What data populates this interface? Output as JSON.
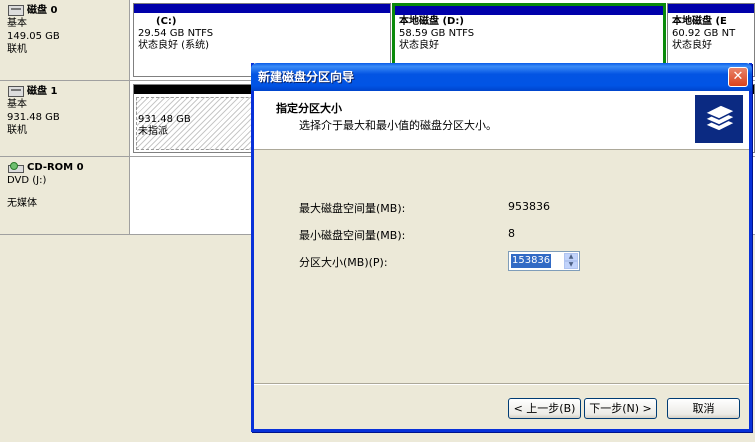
{
  "disks": [
    {
      "name": "磁盘 0",
      "type": "基本",
      "size": "149.05 GB",
      "status": "联机"
    },
    {
      "name": "磁盘 1",
      "type": "基本",
      "size": "931.48 GB",
      "status": "联机"
    },
    {
      "name": "CD-ROM 0",
      "type": "DVD (J:)",
      "status": "无媒体"
    }
  ],
  "partitions": {
    "c": {
      "label": "(C:)",
      "size": "29.54 GB NTFS",
      "status": "状态良好 (系统)"
    },
    "d": {
      "label": "本地磁盘  (D:)",
      "size": "58.59 GB NTFS",
      "status": "状态良好"
    },
    "e": {
      "label": "本地磁盘  (E",
      "size": "60.92 GB NT",
      "status": "状态良好"
    },
    "unalloc": {
      "size": "931.48 GB",
      "status": "未指派"
    }
  },
  "wizard": {
    "title": "新建磁盘分区向导",
    "close": "✕",
    "header_title": "指定分区大小",
    "header_subtitle": "选择介于最大和最小值的磁盘分区大小。",
    "max_label": "最大磁盘空间量(MB):",
    "max_value": "953836",
    "min_label": "最小磁盘空间量(MB):",
    "min_value": "8",
    "size_label": "分区大小(MB)(P):",
    "size_value": "153836",
    "back_button": "< 上一步(B)",
    "next_button": "下一步(N) >",
    "cancel_button": "取消"
  },
  "colors": {
    "accent": "#0831d9",
    "partition_bar": "#0000aa",
    "selected_border": "#0b8a0b"
  }
}
